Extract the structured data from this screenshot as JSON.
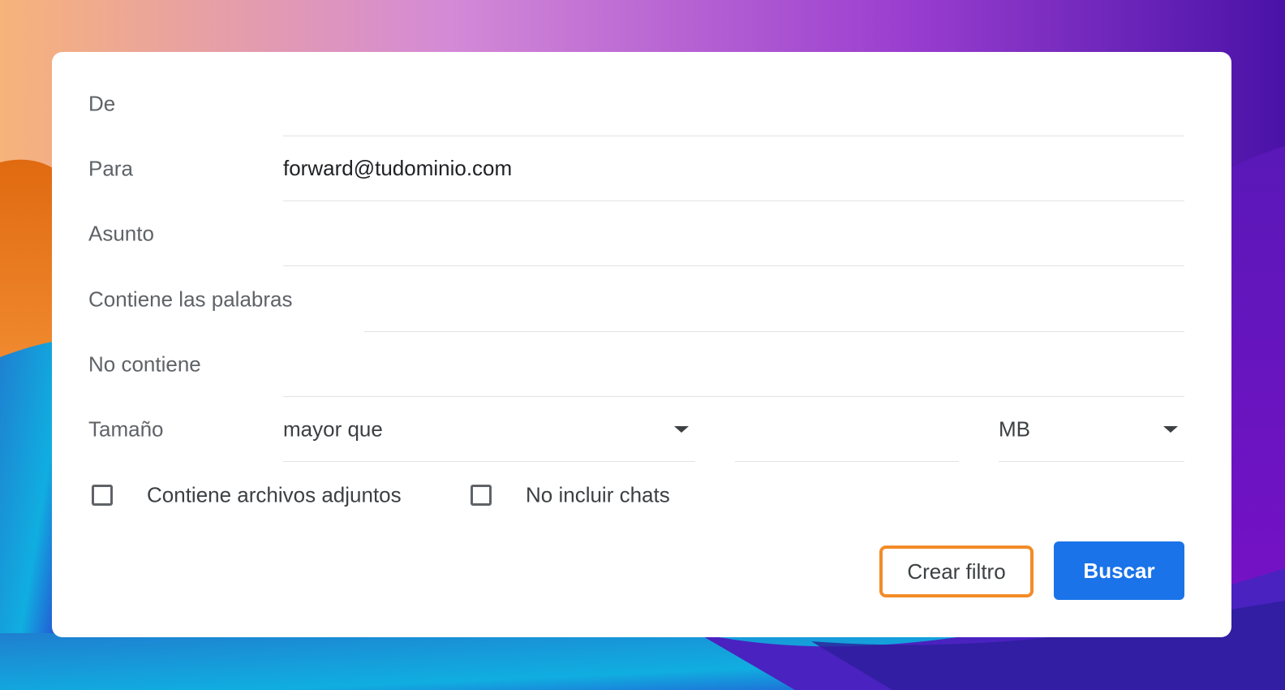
{
  "form": {
    "fields": [
      {
        "label": "De",
        "value": "",
        "placeholder": ""
      },
      {
        "label": "Para",
        "value": "forward@tudominio.com",
        "placeholder": ""
      },
      {
        "label": "Asunto",
        "value": "",
        "placeholder": ""
      },
      {
        "label": "Contiene las palabras",
        "value": "",
        "placeholder": ""
      },
      {
        "label": "No contiene",
        "value": "",
        "placeholder": ""
      }
    ],
    "size": {
      "label": "Tamaño",
      "comparator": "mayor que",
      "amount": "",
      "unit": "MB"
    },
    "checkboxes": [
      {
        "label": "Contiene archivos adjuntos",
        "checked": false
      },
      {
        "label": "No incluir chats",
        "checked": false
      }
    ]
  },
  "actions": {
    "create_filter": "Crear filtro",
    "search": "Buscar"
  },
  "colors": {
    "primary": "#1a73e8",
    "highlight": "#f28c28"
  }
}
